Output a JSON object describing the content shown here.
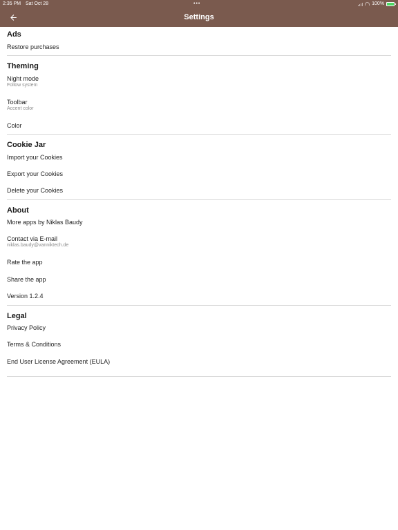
{
  "status": {
    "time": "2:35 PM",
    "date": "Sat Oct 28",
    "dots": "•••",
    "battery": "100%"
  },
  "appbar": {
    "title": "Settings",
    "back_icon": "arrow-left-icon"
  },
  "sections": {
    "ads": {
      "title": "Ads",
      "items": [
        {
          "label": "Restore purchases"
        }
      ]
    },
    "theming": {
      "title": "Theming",
      "items": [
        {
          "label": "Night mode",
          "sub": "Follow system"
        },
        {
          "label": "Toolbar",
          "sub": "Accent color"
        },
        {
          "label": "Color"
        }
      ]
    },
    "cookie_jar": {
      "title": "Cookie Jar",
      "items": [
        {
          "label": "Import your Cookies"
        },
        {
          "label": "Export your Cookies"
        },
        {
          "label": "Delete your Cookies"
        }
      ]
    },
    "about": {
      "title": "About",
      "items": [
        {
          "label": "More apps by Niklas Baudy"
        },
        {
          "label": "Contact via E-mail",
          "sub": "niklas.baudy@vanniktech.de"
        },
        {
          "label": "Rate the app"
        },
        {
          "label": "Share the app"
        },
        {
          "label": "Version 1.2.4"
        }
      ]
    },
    "legal": {
      "title": "Legal",
      "items": [
        {
          "label": "Privacy Policy"
        },
        {
          "label": "Terms & Conditions"
        },
        {
          "label": "End User License Agreement (EULA)"
        }
      ]
    }
  },
  "colors": {
    "appbar": "#7a5a4e",
    "divider": "#d8d8d8"
  }
}
